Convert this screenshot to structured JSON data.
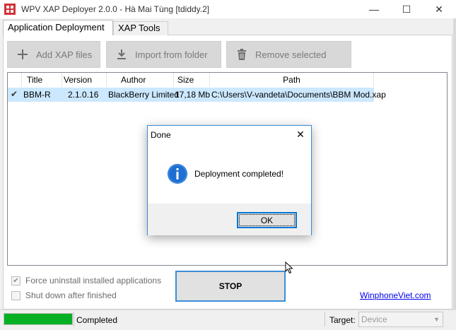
{
  "window": {
    "title": "WPV XAP Deployer 2.0.0 - Hà Mai Tùng [tdiddy.2]",
    "controls": {
      "minimize": "—",
      "maximize": "☐",
      "close": "✕"
    }
  },
  "tabs": [
    {
      "label": "Application Deployment",
      "active": true
    },
    {
      "label": "XAP Tools",
      "active": false
    }
  ],
  "toolbar": {
    "add_label": "Add XAP files",
    "import_label": "Import from folder",
    "remove_label": "Remove selected"
  },
  "table": {
    "columns": [
      "Title",
      "Version",
      "Author",
      "Size",
      "Path"
    ],
    "rows": [
      {
        "checked": true,
        "title": "BBM-R",
        "version": "2.1.0.16",
        "author": "BlackBerry Limited",
        "size": "17,18 Mb",
        "path": "C:\\Users\\V-vandeta\\Documents\\BBM Mod.xap"
      }
    ]
  },
  "dialog": {
    "title": "Done",
    "close_glyph": "✕",
    "message": "Deployment completed!",
    "ok_label": "OK"
  },
  "options": {
    "force_uninstall_label": "Force uninstall installed applications",
    "force_uninstall_checked": true,
    "shutdown_label": "Shut down after finished",
    "shutdown_checked": false
  },
  "stop_label": "STOP",
  "link_text": "WinphoneViet.com",
  "status": {
    "progress_fraction": 1.0,
    "text": "Completed",
    "target_label": "Target:",
    "target_value": "Device"
  },
  "colors": {
    "accent": "#0078d7",
    "progress_green": "#06b025",
    "selection": "#cce8ff"
  }
}
